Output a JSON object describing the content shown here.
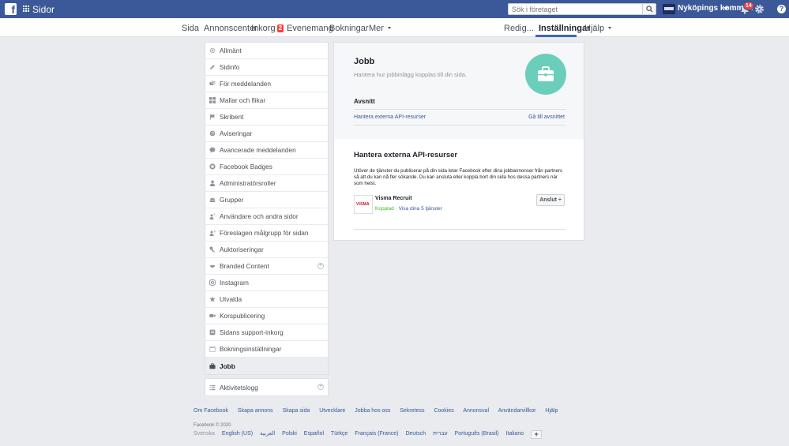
{
  "topbar": {
    "logo": "f",
    "pages_label": "Sidor",
    "search_placeholder": "Sök i företaget",
    "page_name": "Nyköpings kommun",
    "notifications_count": "14",
    "help_label": "?"
  },
  "subnav": {
    "items": [
      "Sida",
      "Annonscenter",
      "Inkorg",
      "Evenemang",
      "Bokningar",
      "Mer"
    ],
    "inbox_badge": "2",
    "right_items": [
      "Redig...",
      "Inställningar",
      "Hjälp"
    ]
  },
  "sidebar": {
    "items": [
      "Allmänt",
      "Sidinfo",
      "För meddelanden",
      "Mallar och flikar",
      "Skribent",
      "Aviseringar",
      "Avancerade meddelanden",
      "Facebook Badges",
      "Administratörsroller",
      "Grupper",
      "Användare och andra sidor",
      "Föreslagen målgrupp för sidan",
      "Auktoriseringar",
      "Branded Content",
      "Instagram",
      "Utvalda",
      "Korspublicering",
      "Sidans support-inkorg",
      "Bokningsinställningar",
      "Jobb"
    ],
    "secondary": [
      "Aktivitetslogg"
    ],
    "expandable": "+"
  },
  "main": {
    "title": "Jobb",
    "description": "Hantera hur jobbinlägg kopplas till din sida.",
    "section_label": "Avsnitt",
    "section_item": "Hantera externa API-resurser",
    "section_goto": "Gå till avsnittet",
    "api_title": "Hantera externa API-resurser",
    "api_description": "Utöver de tjänster du publicerar på din sida letar Facebook efter dina jobbannonser från partners så att du kan nå fler sökande. Du kan ansluta eller koppla bort din sida hos dessa partners när som helst.",
    "partner": {
      "logo_text": "VISMA",
      "name": "Visma Recruit",
      "status": "Kopplad",
      "separator": " · ",
      "services_link": "Visa dina 5 tjänster",
      "button_label": "Anslut ÷"
    }
  },
  "footer": {
    "links": [
      "Om Facebook",
      "Skapa annons",
      "Skapa sida",
      "Utvecklare",
      "Jobba hos oss",
      "Sekretess",
      "Cookies",
      "Annonsval",
      "Användarvillkor",
      "Hjälp"
    ],
    "copyright": "Facebook © 2020",
    "languages": [
      "Svenska",
      "English (US)",
      "العربية",
      "Polski",
      "Español",
      "Türkçe",
      "Français (France)",
      "Deutsch",
      "עברית",
      "Português (Brasil)",
      "Italiano"
    ],
    "lang_more": "+"
  },
  "colors": {
    "brand": "#3b5998",
    "accent": "#4267b2",
    "job_circle": "#6bcebb",
    "connected": "#42b72a"
  }
}
